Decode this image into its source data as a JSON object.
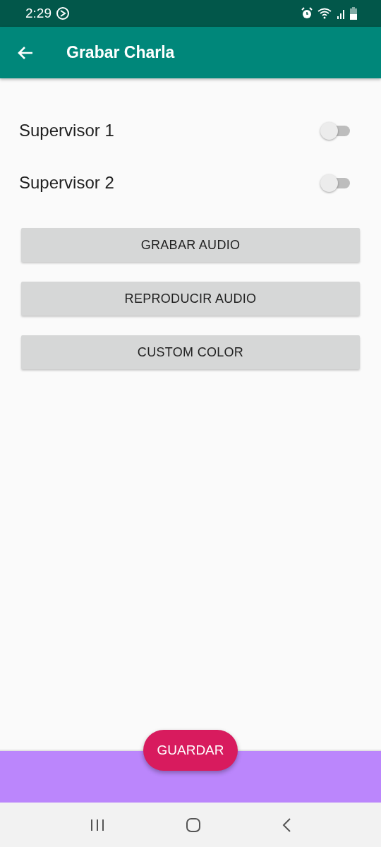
{
  "status_bar": {
    "time": "2:29"
  },
  "app_bar": {
    "title": "Grabar Charla"
  },
  "switches": [
    {
      "label": "Supervisor 1",
      "on": false
    },
    {
      "label": "Supervisor 2",
      "on": false
    }
  ],
  "buttons": [
    "GRABAR AUDIO",
    "REPRODUCIR AUDIO",
    "CUSTOM COLOR"
  ],
  "fab": {
    "label": "GUARDAR"
  }
}
